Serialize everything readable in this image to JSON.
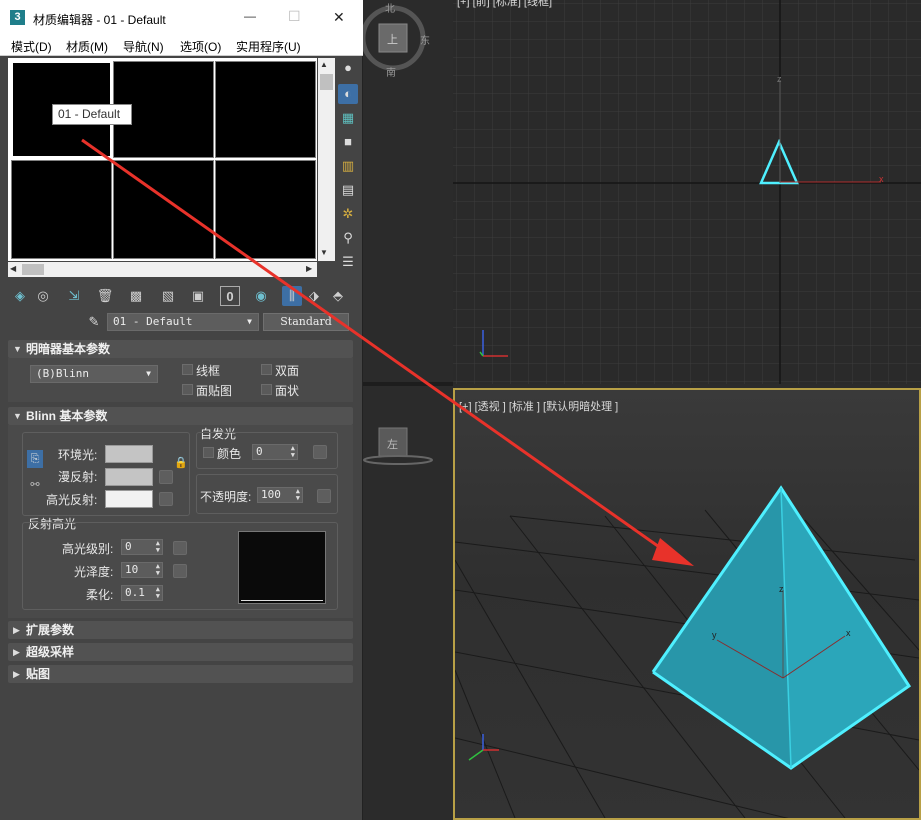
{
  "window": {
    "app_icon": "3",
    "title": "材质编辑器 - 01 - Default",
    "minimize": "—",
    "maximize": "☐",
    "close": "✕"
  },
  "menu": [
    "模式(D)",
    "材质(M)",
    "导航(N)",
    "选项(O)",
    "实用程序(U)"
  ],
  "slots": {
    "tooltip": "01 - Default"
  },
  "material": {
    "name": "01 - Default",
    "type_button": "Standard"
  },
  "shader_rollout": {
    "title": "明暗器基本参数",
    "shader": "(B)Blinn",
    "wire": "线框",
    "two_sided": "双面",
    "face_map": "面贴图",
    "faceted": "面状"
  },
  "blinn_rollout": {
    "title": "Blinn 基本参数",
    "ambient": "环境光:",
    "diffuse": "漫反射:",
    "specular": "高光反射:",
    "self_illum_group": "自发光",
    "color": "颜色",
    "self_illum_value": "0",
    "opacity_label": "不透明度:",
    "opacity_value": "100",
    "spec_group": "反射高光",
    "spec_level_label": "高光级别:",
    "spec_level_value": "0",
    "gloss_label": "光泽度:",
    "gloss_value": "10",
    "soften_label": "柔化:",
    "soften_value": "0.1"
  },
  "collapsed_rollouts": [
    "扩展参数",
    "超级采样",
    "贴图"
  ],
  "viewcube": {
    "north": "北",
    "east": "东",
    "south": "南",
    "top_face": "上",
    "left_face": "左"
  },
  "viewports": {
    "top_label": "[+] [前] [标准] [线框]",
    "persp_label": "[+] [透视 ] [标准 ] [默认明暗处理 ]"
  },
  "axes": {
    "x": "x",
    "y": "y",
    "z": "z"
  },
  "colors": {
    "pyramid_fill": "#2aa0b4",
    "pyramid_edge": "#4ff0ff",
    "annotation_arrow": "#e8322a",
    "ambient_swatch": "#c4c4c4",
    "diffuse_swatch": "#c4c4c4",
    "specular_swatch": "#f2f2f2",
    "viewport_border": "#b8a046"
  }
}
